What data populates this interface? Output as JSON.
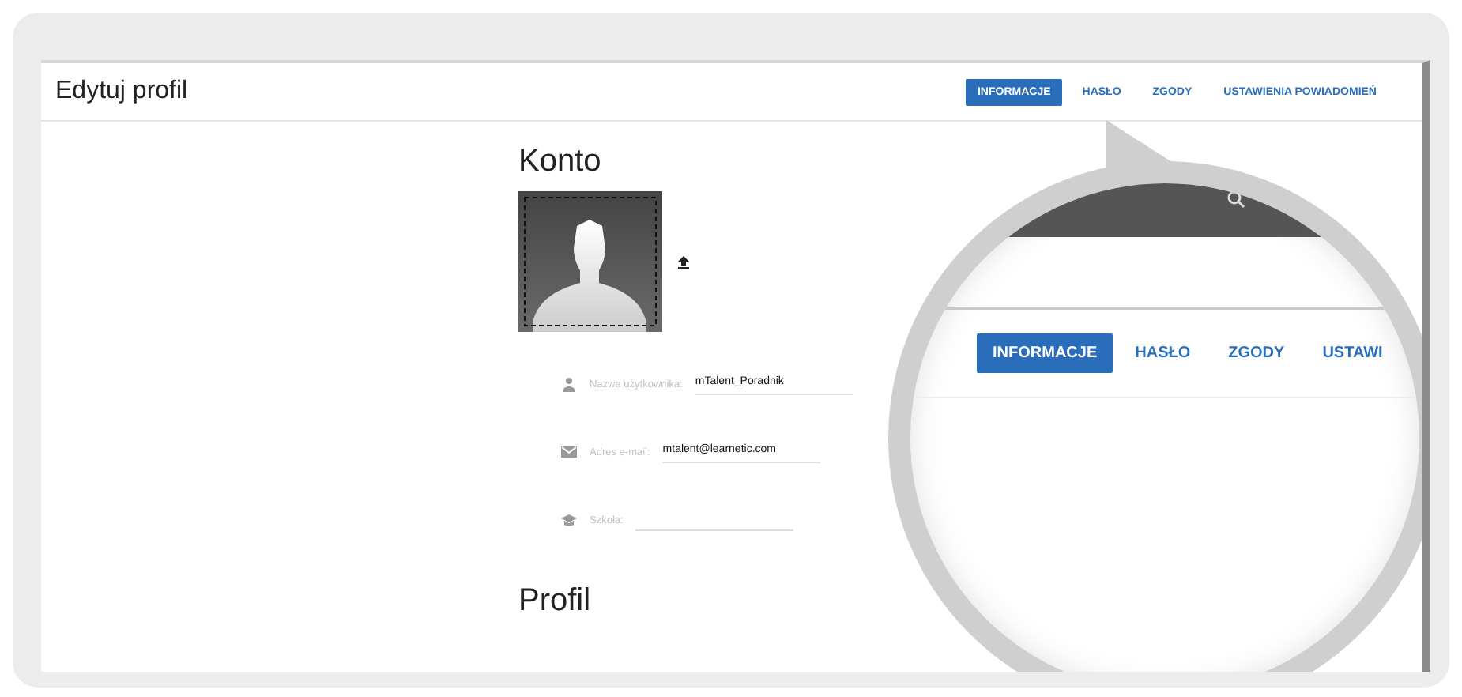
{
  "header": {
    "title": "Edytuj profil"
  },
  "tabs": [
    {
      "label": "INFORMACJE",
      "selected": true
    },
    {
      "label": "HASŁO",
      "selected": false
    },
    {
      "label": "ZGODY",
      "selected": false
    },
    {
      "label": "USTAWIENIA POWIADOMIEŃ",
      "selected": false
    }
  ],
  "account": {
    "heading": "Konto",
    "fields": [
      {
        "kind": "user",
        "label": "Nazwa użytkownika:",
        "value": "mTalent_Poradnik"
      },
      {
        "kind": "mail",
        "label": "Adres e-mail:",
        "value": "mtalent@learnetic.com"
      },
      {
        "kind": "school",
        "label": "Szkoła:"
      }
    ]
  },
  "profile": {
    "heading": "Profil"
  },
  "magnifier": {
    "tabs": [
      {
        "label": "INFORMACJE",
        "selected": true
      },
      {
        "label": "HASŁO",
        "selected": false
      },
      {
        "label": "ZGODY",
        "selected": false
      },
      {
        "label": "USTAWI",
        "selected": false
      }
    ]
  }
}
